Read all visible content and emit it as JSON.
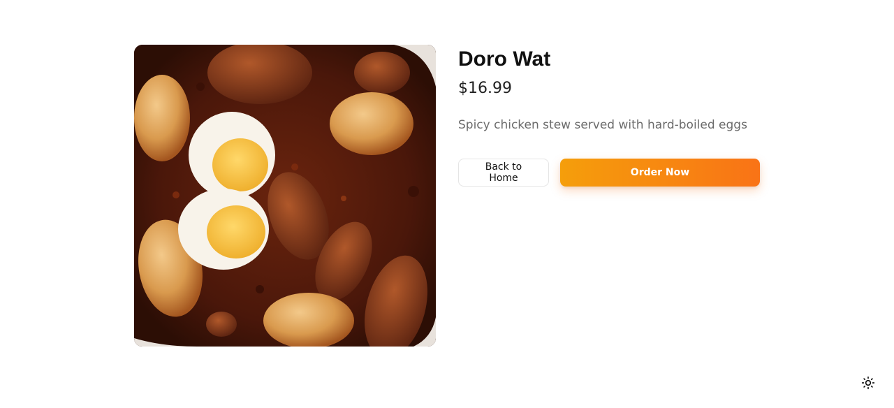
{
  "product": {
    "name": "Doro Wat",
    "price": "$16.99",
    "description": "Spicy chicken stew served with hard-boiled eggs",
    "image_icon": "food-photo"
  },
  "actions": {
    "back_label": "Back to Home",
    "order_label": "Order Now"
  },
  "theme_toggle": {
    "icon": "sun-icon"
  },
  "colors": {
    "accent_start": "#f59e0b",
    "accent_end": "#f97316",
    "title": "#111111",
    "description": "#6b6b6b"
  }
}
